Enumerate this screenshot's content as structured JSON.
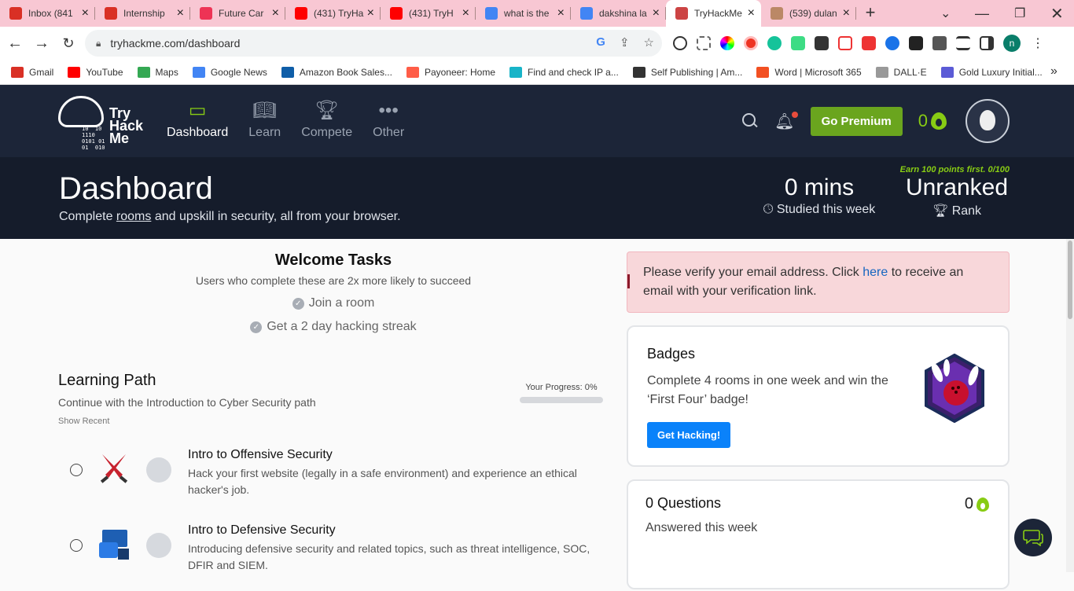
{
  "browser": {
    "tabs": [
      {
        "title": "Inbox (841",
        "icon": "gmail-icon",
        "color": "#d93025"
      },
      {
        "title": "Internship",
        "icon": "gmail-icon",
        "color": "#d93025"
      },
      {
        "title": "Future Car",
        "icon": "futurecar-icon",
        "color": "#e35"
      },
      {
        "title": "(431) TryHa",
        "icon": "youtube-icon",
        "color": "#f00"
      },
      {
        "title": "(431) TryH",
        "icon": "youtube-icon",
        "color": "#f00"
      },
      {
        "title": "what is the",
        "icon": "google-icon",
        "color": "#4285f4"
      },
      {
        "title": "dakshina la",
        "icon": "google-icon",
        "color": "#4285f4"
      },
      {
        "title": "TryHackMe",
        "icon": "tryhackme-icon",
        "color": "#c44",
        "active": true
      },
      {
        "title": "(539) dulan",
        "icon": "youtube-icon",
        "color": "#b86"
      }
    ],
    "url": "tryhackme.com/dashboard",
    "profile_initial": "n",
    "bookmarks": [
      {
        "label": "Gmail",
        "color": "#d93025"
      },
      {
        "label": "YouTube",
        "color": "#f00"
      },
      {
        "label": "Maps",
        "color": "#34a853"
      },
      {
        "label": "Google News",
        "color": "#4285f4"
      },
      {
        "label": "Amazon Book Sales...",
        "color": "#0f5ea8"
      },
      {
        "label": "Payoneer: Home",
        "color": "#ff5d47"
      },
      {
        "label": "Find and check IP a...",
        "color": "#18b4c8"
      },
      {
        "label": "Self Publishing | Am...",
        "color": "#333"
      },
      {
        "label": "Word | Microsoft 365",
        "color": "#f25022"
      },
      {
        "label": "DALL·E",
        "color": "#999"
      },
      {
        "label": "Gold Luxury Initial...",
        "color": "#5b5bd6"
      }
    ]
  },
  "site": {
    "logo": {
      "bits": "10  10\n1110\n0101 01\n01  010",
      "word": "Try\nHack\nMe"
    },
    "nav": [
      {
        "label": "Dashboard",
        "active": true
      },
      {
        "label": "Learn"
      },
      {
        "label": "Compete"
      },
      {
        "label": "Other"
      }
    ],
    "premium_label": "Go Premium",
    "streak_count": "0"
  },
  "hero": {
    "title": "Dashboard",
    "subtitle_pre": "Complete ",
    "subtitle_link": "rooms",
    "subtitle_post": " and upskill in security, all from your browser.",
    "studied_value": "0 mins",
    "studied_label": "Studied this week",
    "rank_value": "Unranked",
    "rank_label": "Rank",
    "earn_text": "Earn 100 points first. 0/100"
  },
  "welcome": {
    "title": "Welcome Tasks",
    "description": "Users who complete these are 2x more likely to succeed",
    "tasks": [
      "Join a room",
      "Get a 2 day hacking streak"
    ]
  },
  "learning_path": {
    "title": "Learning Path",
    "description": "Continue with the Introduction to Cyber Security path",
    "show_recent": "Show Recent",
    "progress_label": "Your Progress: 0%",
    "progress": 0,
    "rooms": [
      {
        "title": "Intro to Offensive Security",
        "description": "Hack your first website (legally in a safe environment) and experience an ethical hacker's job."
      },
      {
        "title": "Intro to Defensive Security",
        "description": "Introducing defensive security and related topics, such as threat intelligence, SOC, DFIR and SIEM."
      }
    ]
  },
  "alert": {
    "text_pre": "Please verify your email address. Click ",
    "link": "here",
    "text_post": " to receive an email with your verification link."
  },
  "badges": {
    "title": "Badges",
    "description": "Complete 4 rooms in one week and win the ‘First Four’ badge!",
    "button": "Get Hacking!"
  },
  "questions": {
    "title": "0 Questions",
    "description": "Answered this week",
    "count": "0"
  }
}
